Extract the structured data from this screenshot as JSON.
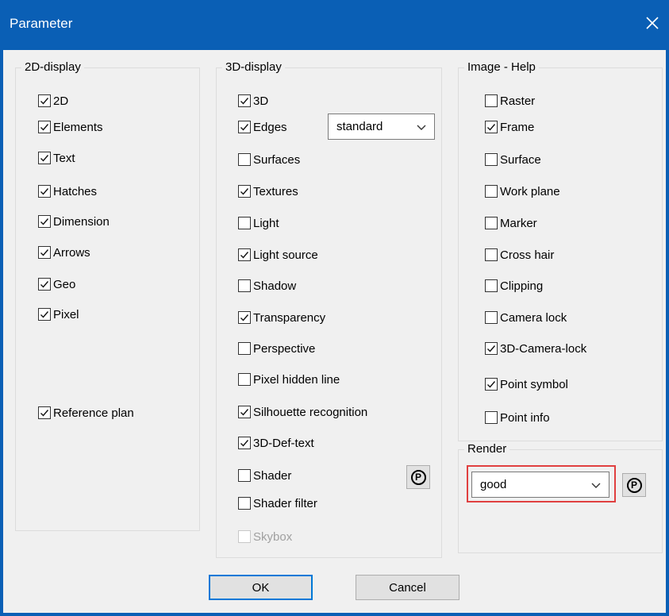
{
  "window": {
    "title": "Parameter",
    "close_symbol": "✕"
  },
  "groups": {
    "display_2d": {
      "legend": "2D-display",
      "items": [
        {
          "label": "2D",
          "checked": true
        },
        {
          "label": "Elements",
          "checked": true
        },
        {
          "label": "Text",
          "checked": true
        },
        {
          "label": "Hatches",
          "checked": true
        },
        {
          "label": "Dimension",
          "checked": true
        },
        {
          "label": "Arrows",
          "checked": true
        },
        {
          "label": "Geo",
          "checked": true
        },
        {
          "label": "Pixel",
          "checked": true
        },
        {
          "label": "Reference plan",
          "checked": true
        }
      ]
    },
    "display_3d": {
      "legend": "3D-display",
      "items": [
        {
          "label": "3D",
          "checked": true
        },
        {
          "label": "Edges",
          "checked": true
        },
        {
          "label": "Surfaces",
          "checked": false
        },
        {
          "label": "Textures",
          "checked": true
        },
        {
          "label": "Light",
          "checked": false
        },
        {
          "label": "Light source",
          "checked": true
        },
        {
          "label": "Shadow",
          "checked": false
        },
        {
          "label": "Transparency",
          "checked": true
        },
        {
          "label": "Perspective",
          "checked": false
        },
        {
          "label": "Pixel hidden line",
          "checked": false
        },
        {
          "label": "Silhouette recognition",
          "checked": true
        },
        {
          "label": "3D-Def-text",
          "checked": true
        },
        {
          "label": "Shader",
          "checked": false
        },
        {
          "label": "Shader filter",
          "checked": false
        },
        {
          "label": "Skybox",
          "checked": false,
          "disabled": true
        }
      ],
      "edges_select": "standard",
      "shader_button": "P"
    },
    "image_help": {
      "legend": "Image - Help",
      "items": [
        {
          "label": "Raster",
          "checked": false
        },
        {
          "label": "Frame",
          "checked": true
        },
        {
          "label": "Surface",
          "checked": false
        },
        {
          "label": "Work plane",
          "checked": false
        },
        {
          "label": "Marker",
          "checked": false
        },
        {
          "label": "Cross hair",
          "checked": false
        },
        {
          "label": "Clipping",
          "checked": false
        },
        {
          "label": "Camera lock",
          "checked": false
        },
        {
          "label": "3D-Camera-lock",
          "checked": true
        },
        {
          "label": "Point symbol",
          "checked": true
        },
        {
          "label": "Point info",
          "checked": false
        }
      ]
    },
    "render": {
      "legend": "Render",
      "select": "good",
      "button": "P"
    }
  },
  "buttons": {
    "ok": "OK",
    "cancel": "Cancel"
  },
  "colors": {
    "titlebar": "#0a5fb5",
    "highlight": "#e04040",
    "default_button_border": "#0078d7"
  }
}
